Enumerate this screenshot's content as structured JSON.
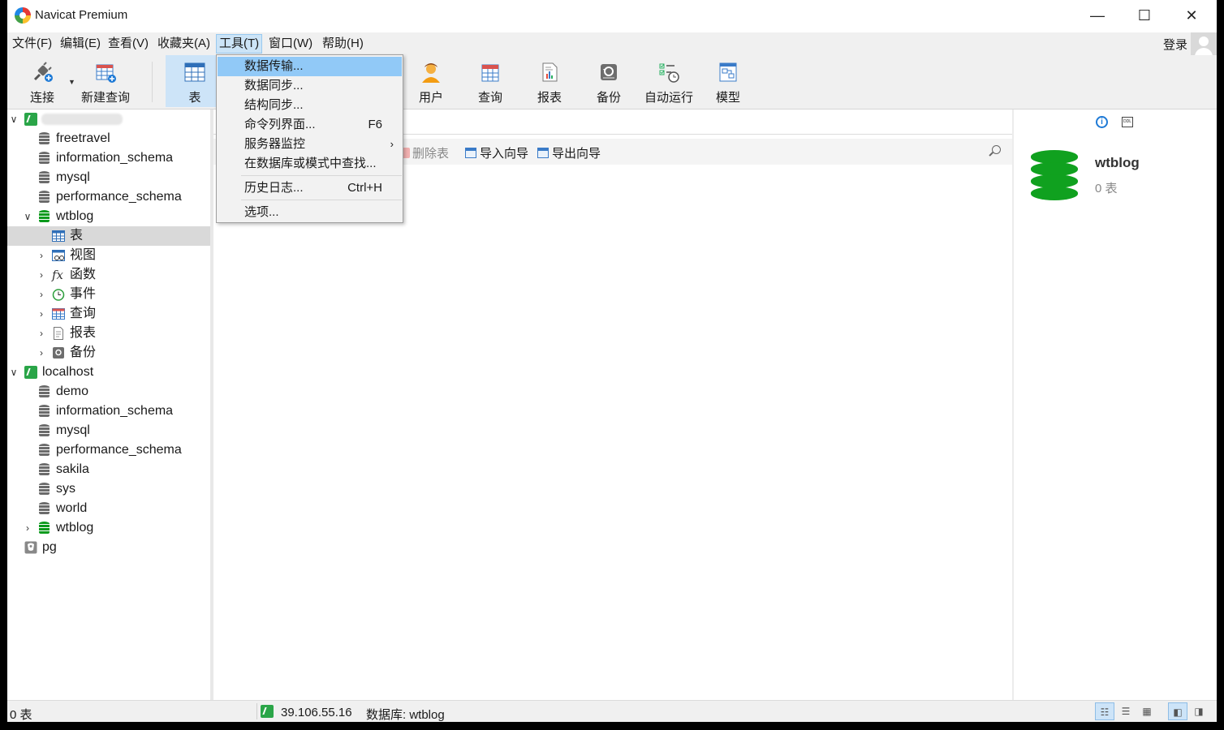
{
  "window": {
    "title": "Navicat Premium"
  },
  "menubar": {
    "items": [
      "文件(F)",
      "编辑(E)",
      "查看(V)",
      "收藏夹(A)",
      "工具(T)",
      "窗口(W)",
      "帮助(H)"
    ],
    "login": "登录"
  },
  "toolbar": {
    "connect": "连接",
    "new_query": "新建查询",
    "table": "表",
    "user": "用户",
    "query": "查询",
    "report": "报表",
    "backup": "备份",
    "automation": "自动运行",
    "model": "模型"
  },
  "tools_menu": {
    "items": [
      {
        "label": "数据传输...",
        "shortcut": ""
      },
      {
        "label": "数据同步...",
        "shortcut": ""
      },
      {
        "label": "结构同步...",
        "shortcut": ""
      },
      {
        "label": "命令列界面...",
        "shortcut": "F6"
      },
      {
        "label": "服务器监控",
        "shortcut": ""
      },
      {
        "label": "在数据库或模式中查找...",
        "shortcut": ""
      },
      {
        "label": "历史日志...",
        "shortcut": "Ctrl+H"
      },
      {
        "label": "选项...",
        "shortcut": ""
      }
    ]
  },
  "tree": {
    "conn1": {
      "name": "",
      "databases": [
        "freetravel",
        "information_schema",
        "mysql",
        "performance_schema"
      ],
      "open_db": "wtblog",
      "db_children": [
        "表",
        "视图",
        "函数",
        "事件",
        "查询",
        "报表",
        "备份"
      ]
    },
    "conn2": {
      "name": "localhost",
      "databases": [
        "demo",
        "information_schema",
        "mysql",
        "performance_schema",
        "sakila",
        "sys",
        "world",
        "wtblog"
      ]
    },
    "conn3": {
      "name": "pg"
    }
  },
  "object_toolbar": {
    "delete_table": "删除表",
    "import_wizard": "导入向导",
    "export_wizard": "导出向导"
  },
  "info_panel": {
    "db_name": "wtblog",
    "table_count": "0 表"
  },
  "status": {
    "left": "0 表",
    "host": "39.106.55.16",
    "database": "数据库: wtblog"
  }
}
